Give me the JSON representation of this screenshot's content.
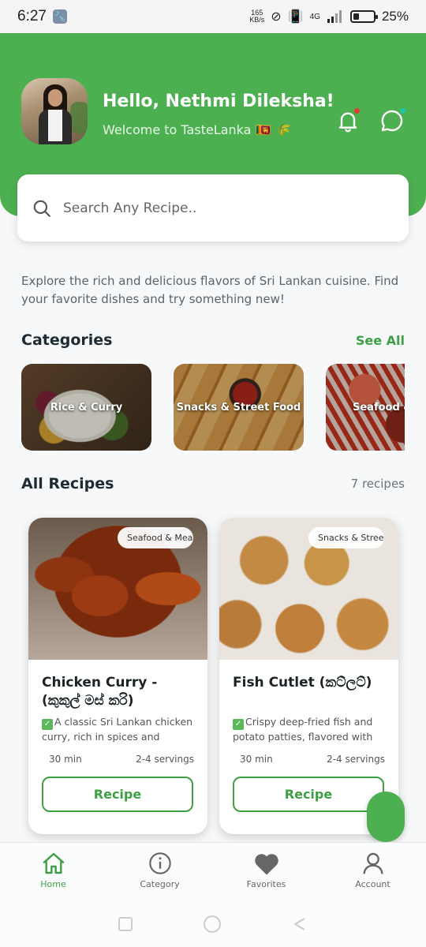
{
  "status_bar": {
    "time": "6:27",
    "net_speed_value": "165",
    "net_speed_unit": "KB/s",
    "network": "4G",
    "battery_percent": "25%",
    "battery_level": 0.25
  },
  "header": {
    "greeting": "Hello, Nethmi Dileksha!",
    "subtitle": "Welcome to TasteLanka 🇱🇰 🌾",
    "notification_dot_color": "#e53935",
    "message_dot_color": "#1fc4a4"
  },
  "search": {
    "placeholder": "Search Any Recipe.."
  },
  "intro": "Explore the rich and delicious flavors of Sri Lankan cuisine. Find your favorite dishes and try something new!",
  "categories": {
    "title": "Categories",
    "see_all": "See All",
    "items": [
      {
        "label": "Rice & Curry"
      },
      {
        "label": "Snacks & Street Food"
      },
      {
        "label": "Seafood & Meat"
      }
    ]
  },
  "recipes": {
    "title": "All Recipes",
    "count_label": "7 recipes",
    "items": [
      {
        "tag": "Seafood & Meat",
        "title": "Chicken Curry - (කුකුල් මස් කරි)",
        "description": "A classic Sri Lankan chicken curry, rich in spices and cream...",
        "time": "30 min",
        "servings": "2-4 servings",
        "button": "Recipe"
      },
      {
        "tag": "Snacks & Street Food",
        "title": "Fish Cutlet (කට්ලට්)",
        "description": "Crispy deep-fried fish and potato patties, flavored with spices...",
        "time": "30 min",
        "servings": "2-4 servings",
        "button": "Recipe"
      }
    ]
  },
  "bottom_nav": {
    "items": [
      {
        "label": "Home",
        "icon": "home-icon",
        "active": true
      },
      {
        "label": "Category",
        "icon": "info-icon",
        "active": false
      },
      {
        "label": "Favorites",
        "icon": "heart-icon",
        "active": false
      },
      {
        "label": "Account",
        "icon": "user-icon",
        "active": false
      }
    ]
  },
  "colors": {
    "brand_green": "#4caf50",
    "accent_green": "#3f9f45"
  }
}
